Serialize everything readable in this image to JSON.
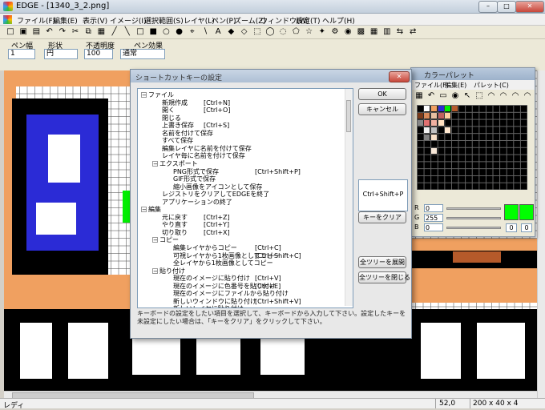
{
  "window": {
    "title": "EDGE - [1340_3_2.png]",
    "controls": [
      "–",
      "□",
      "✕"
    ]
  },
  "menu": [
    "ファイル(F)",
    "編集(E)",
    "表示(V)",
    "イメージ(I)",
    "選択範囲(S)",
    "レイヤ(L)",
    "ペン(P)",
    "ズーム(Z)",
    "ウィンドウ(W)",
    "設定(T)",
    "ヘルプ(H)"
  ],
  "toolbar_icons": [
    "new-file-icon",
    "open-folder-icon",
    "save-icon",
    "select-icon",
    "hand-icon",
    "pencil-icon",
    "line-icon",
    "undo-icon",
    "redo-icon",
    "cut-icon",
    "copy-icon",
    "paste-icon",
    "pen-icon",
    "line-tool-icon",
    "rect-icon",
    "filled-rect-icon",
    "ellipse-icon",
    "filled-ellipse-icon",
    "dropper-icon",
    "brush-icon",
    "text-icon",
    "fill-icon",
    "eraser-icon",
    "rect-select-icon",
    "ellipse-select-icon",
    "lasso-icon",
    "polygon-select-icon",
    "star-icon",
    "magic-wand-icon",
    "gear-icon",
    "palette-icon",
    "grid-icon",
    "tile-icon",
    "stamp-icon",
    "arrows-icon",
    "swap-icon"
  ],
  "toolbar_glyphs": [
    "□",
    "▣",
    "▤",
    "↶",
    "↷",
    "✂",
    "⧉",
    "▦",
    "╱",
    "╲",
    "□",
    "■",
    "○",
    "●",
    "⌖",
    "∖",
    "A",
    "◆",
    "◇",
    "⬚",
    "◯",
    "◌",
    "⬠",
    "☆",
    "✦",
    "⚙",
    "◉",
    "▩",
    "▦",
    "▥",
    "⇆",
    "⇄"
  ],
  "pen_props": {
    "labels": [
      "ペン幅",
      "形状",
      "不透明度",
      "ペン効果"
    ],
    "width": "1",
    "shape": "円",
    "opacity": "100",
    "effect": "通常"
  },
  "status": {
    "left": "レディ",
    "zoom": "52,0",
    "size": "200 x 40 x 4"
  },
  "palette": {
    "title": "カラーパレット",
    "menu": [
      "ファイル(F)",
      "編集(E)",
      "パレット(C)"
    ],
    "value_labels": [
      "R",
      "G",
      "B"
    ],
    "values": [
      "0",
      "255",
      "0"
    ],
    "nums": [
      "0",
      "0"
    ],
    "accent": "#00ff00"
  },
  "dialog": {
    "title": "ショートカットキーの設定",
    "close": "✕",
    "buttons": {
      "ok": "OK",
      "cancel": "キャンセル",
      "clear": "キーをクリア",
      "expand": "全ツリーを展開",
      "collapse": "全ツリーを閉じる"
    },
    "key_value": "Ctrl+Shift+P",
    "help": "キーボードの設定をしたい項目を選択して、キーボードから入力して下さい。設定したキーを未設定にしたい場合は、「キーをクリア」をクリックして下さい。",
    "tree": [
      {
        "label": "ファイル",
        "key": "",
        "level": 0,
        "expand": "−"
      },
      {
        "label": "新規作成",
        "key": "[Ctrl+N]",
        "level": 1
      },
      {
        "label": "開く",
        "key": "[Ctrl+O]",
        "level": 1
      },
      {
        "label": "閉じる",
        "key": "",
        "level": 1
      },
      {
        "label": "上書き保存",
        "key": "[Ctrl+S]",
        "level": 1
      },
      {
        "label": "名前を付けて保存",
        "key": "",
        "level": 1
      },
      {
        "label": "すべて保存",
        "key": "",
        "level": 1
      },
      {
        "label": "編集レイヤに名前を付けて保存",
        "key": "",
        "level": 1
      },
      {
        "label": "レイヤ毎に名前を付けて保存",
        "key": "",
        "level": 1
      },
      {
        "label": "エクスポート",
        "key": "",
        "level": 1,
        "expand": "−"
      },
      {
        "label": "PNG形式で保存",
        "key": "[Ctrl+Shift+P]",
        "level": 2
      },
      {
        "label": "GIF形式で保存",
        "key": "",
        "level": 2
      },
      {
        "label": "縮小画像をアイコンとして保存",
        "key": "",
        "level": 2
      },
      {
        "label": "レジストリをクリアしてEDGEを終了",
        "key": "",
        "level": 1
      },
      {
        "label": "アプリケーションの終了",
        "key": "",
        "level": 1
      },
      {
        "label": "編集",
        "key": "",
        "level": 0,
        "expand": "−"
      },
      {
        "label": "元に戻す",
        "key": "[Ctrl+Z]",
        "level": 1
      },
      {
        "label": "やり直す",
        "key": "[Ctrl+Y]",
        "level": 1
      },
      {
        "label": "切り取り",
        "key": "[Ctrl+X]",
        "level": 1
      },
      {
        "label": "コピー",
        "key": "",
        "level": 1,
        "expand": "−"
      },
      {
        "label": "編集レイヤからコピー",
        "key": "[Ctrl+C]",
        "level": 2
      },
      {
        "label": "可視レイヤから1枚画像としてコピー",
        "key": "[Ctrl+Shift+C]",
        "level": 2
      },
      {
        "label": "全レイヤから1枚画像としてコピー",
        "key": "",
        "level": 2
      },
      {
        "label": "貼り付け",
        "key": "",
        "level": 1,
        "expand": "−"
      },
      {
        "label": "現在のイメージに貼り付け",
        "key": "[Ctrl+V]",
        "level": 2
      },
      {
        "label": "現在のイメージに色番号を貼り付け",
        "key": "[Ctrl+E]",
        "level": 2
      },
      {
        "label": "現在のイメージにファイルから貼り付け",
        "key": "",
        "level": 2
      },
      {
        "label": "新しいウィンドウに貼り付け",
        "key": "[Ctrl+Shift+V]",
        "level": 2
      },
      {
        "label": "新しいレイヤに貼り付け",
        "key": "",
        "level": 2
      }
    ]
  },
  "colors": {
    "orange": "#f0a060",
    "blue": "#2b2bd6",
    "black": "#000000",
    "green": "#00ee00"
  }
}
